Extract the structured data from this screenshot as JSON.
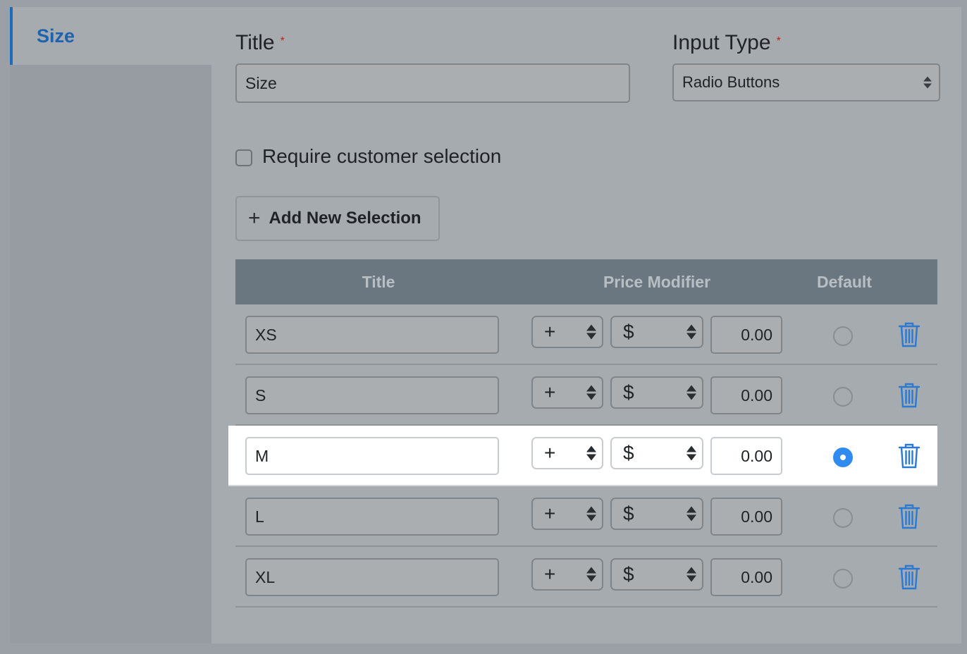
{
  "sidebar": {
    "items": [
      {
        "label": "Size"
      }
    ]
  },
  "form": {
    "title_label": "Title",
    "title_value": "Size",
    "input_type_label": "Input Type",
    "input_type_value": "Radio Buttons",
    "required_mark": "*",
    "require_selection_label": "Require customer selection",
    "require_selection_checked": false,
    "add_button_label": "Add New Selection"
  },
  "table": {
    "headers": {
      "title": "Title",
      "price": "Price Modifier",
      "default": "Default"
    },
    "rows": [
      {
        "title": "XS",
        "op": "+",
        "currency": "$",
        "amount": "0.00",
        "default": false
      },
      {
        "title": "S",
        "op": "+",
        "currency": "$",
        "amount": "0.00",
        "default": false
      },
      {
        "title": "M",
        "op": "+",
        "currency": "$",
        "amount": "0.00",
        "default": true
      },
      {
        "title": "L",
        "op": "+",
        "currency": "$",
        "amount": "0.00",
        "default": false
      },
      {
        "title": "XL",
        "op": "+",
        "currency": "$",
        "amount": "0.00",
        "default": false
      }
    ]
  },
  "colors": {
    "accent": "#1e63ad",
    "radio_selected": "#2f8bf0",
    "trash": "#2a7ad4",
    "required": "#c0271d"
  }
}
